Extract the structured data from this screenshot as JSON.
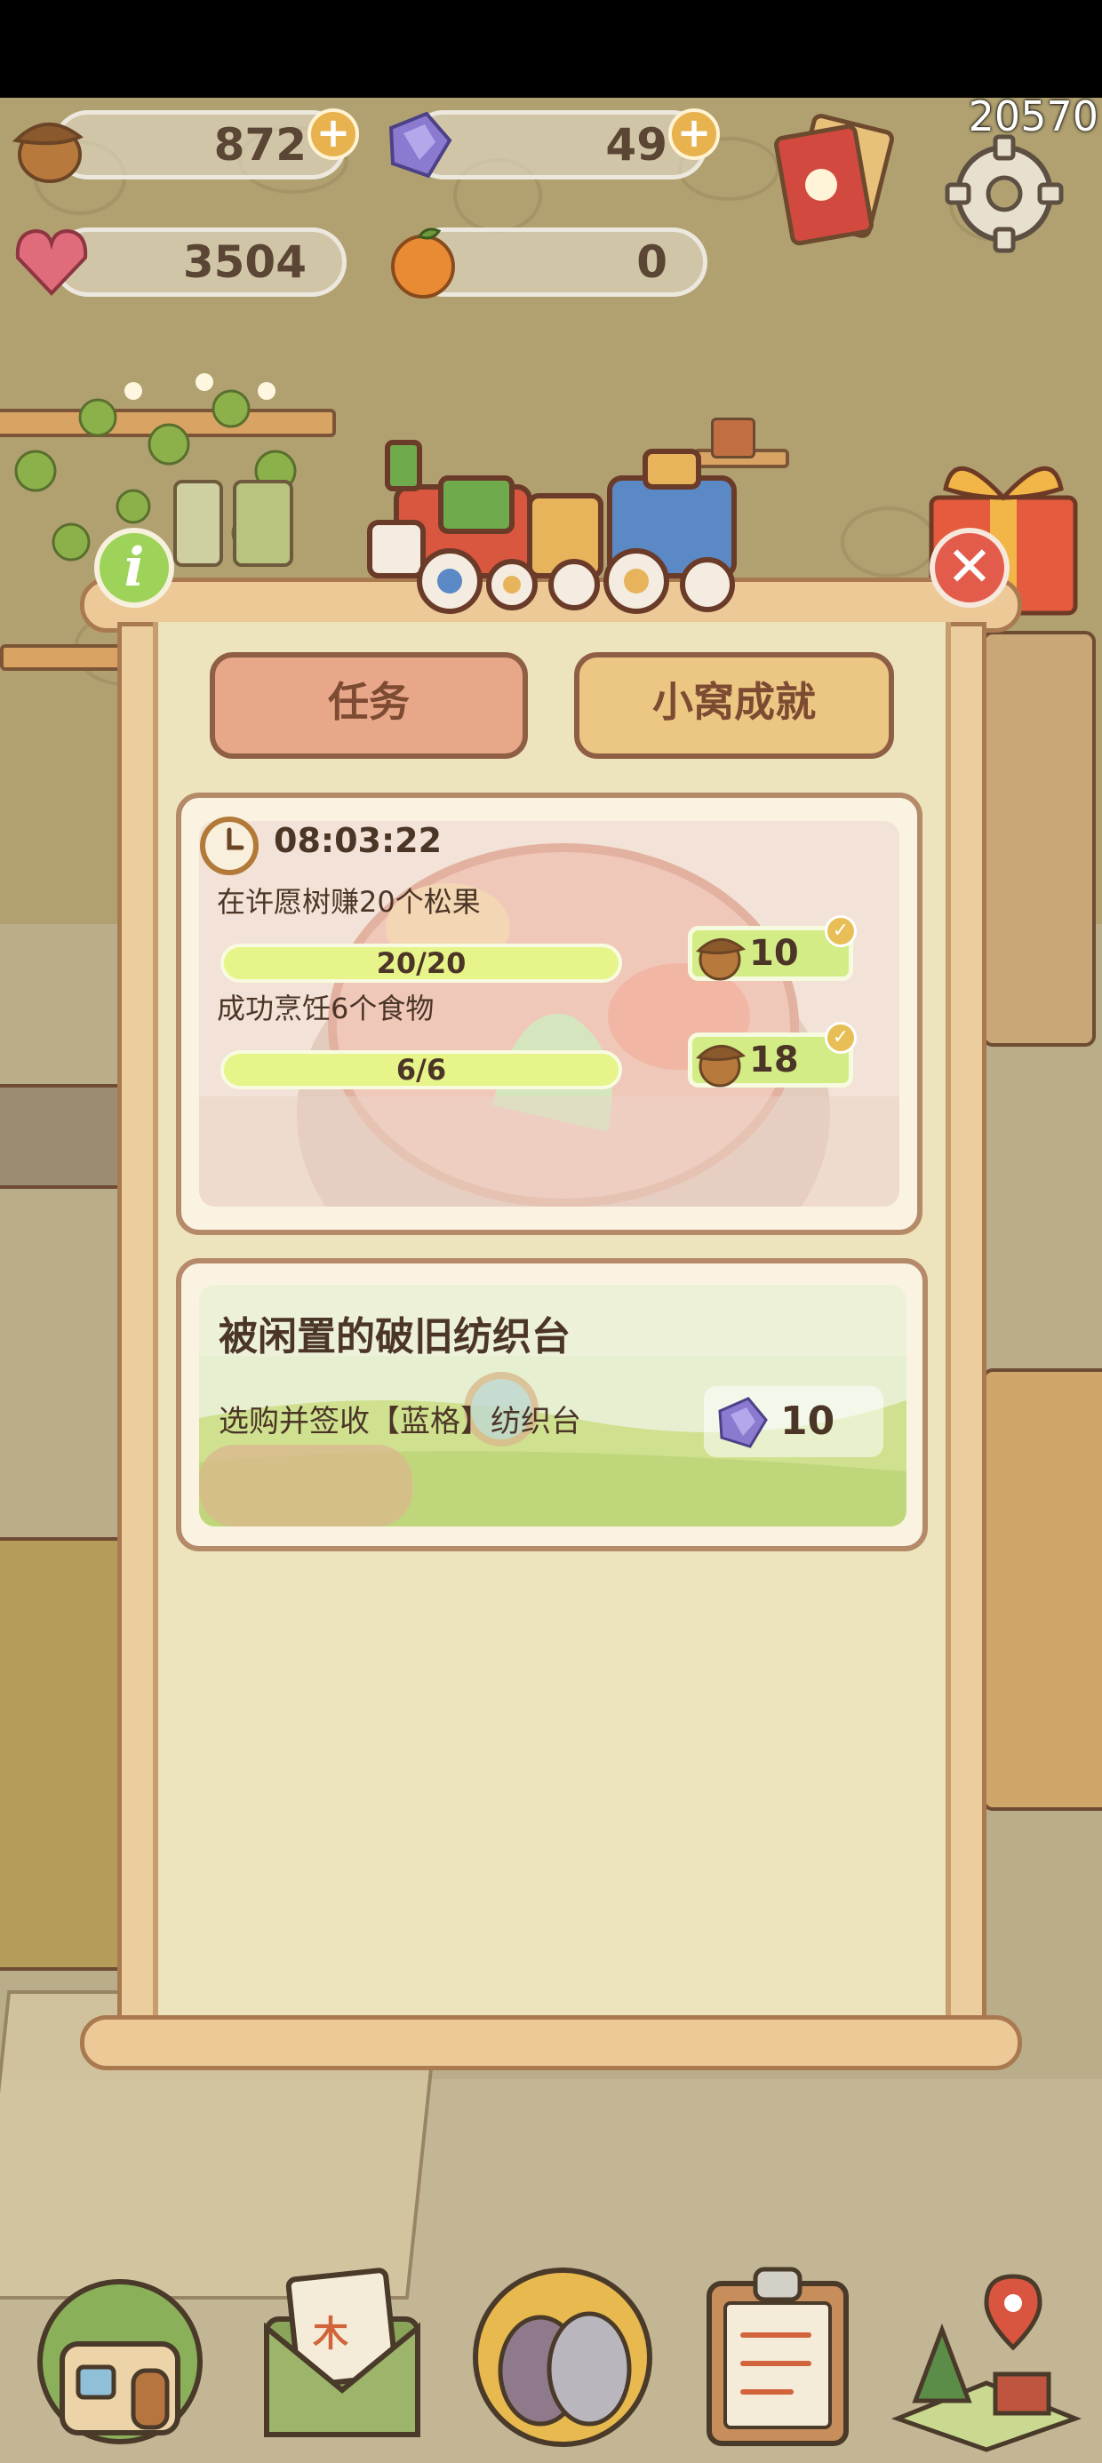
{
  "hud": {
    "acorns": "872",
    "gems": "49",
    "hearts": "3504",
    "oranges": "0",
    "counter": "20570"
  },
  "tabs": {
    "tasks": "任务",
    "achievements": "小窝成就"
  },
  "daily_card": {
    "timer": "08:03:22",
    "tasks": [
      {
        "title": "在许愿树赚20个松果",
        "progress_text": "20/20",
        "progress": 1.0,
        "reward": "10",
        "completed": true
      },
      {
        "title": "成功烹饪6个食物",
        "progress_text": "6/6",
        "progress": 1.0,
        "reward": "18",
        "completed": true
      }
    ]
  },
  "story_card": {
    "title": "被闲置的破旧纺织台",
    "description": "选购并签收【蓝格】纺织台",
    "reward": "10"
  },
  "colors": {
    "tab_active": "#e9a78a",
    "tab_inactive": "#ebc783",
    "progress_fill": "#e7f48a",
    "reward_bg": "#d3ec86",
    "close": "#e35b4b",
    "info": "#9ed35a"
  },
  "icons": [
    "acorn-icon",
    "gem-icon",
    "heart-gem-icon",
    "orange-icon",
    "cards-icon",
    "gear-icon",
    "gift-icon",
    "clock-icon",
    "home-icon",
    "mail-icon",
    "eggs-icon",
    "checklist-icon",
    "map-icon"
  ]
}
